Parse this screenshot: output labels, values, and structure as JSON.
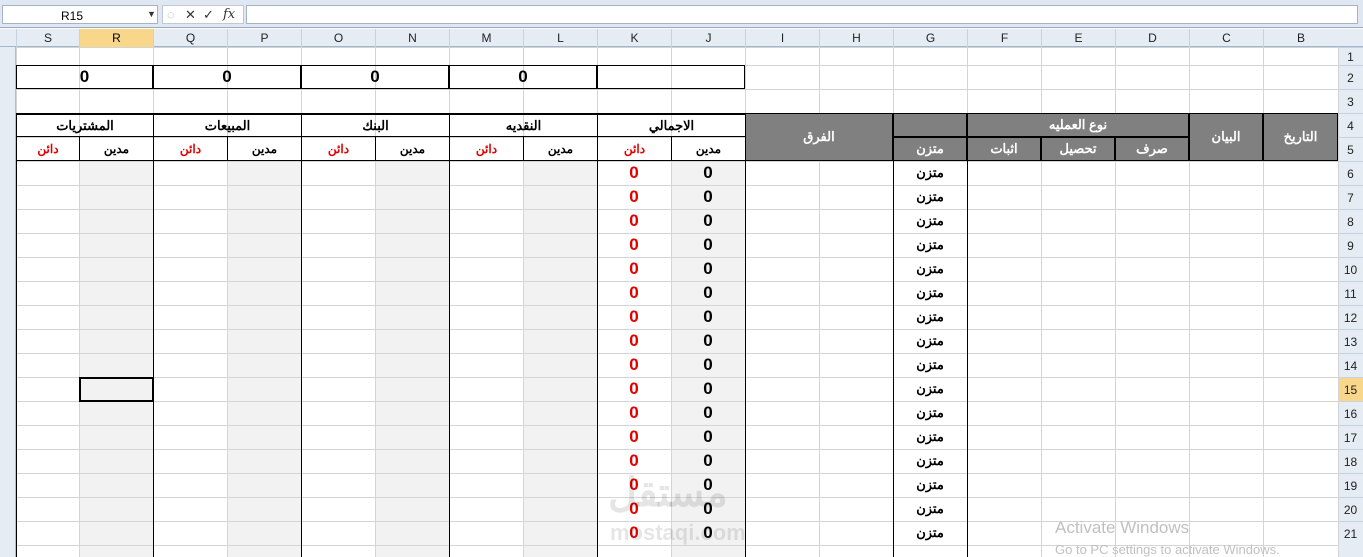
{
  "formula_bar": {
    "name_box": "R15",
    "formula": ""
  },
  "columns": [
    "S",
    "R",
    "Q",
    "P",
    "O",
    "N",
    "M",
    "L",
    "K",
    "J",
    "I",
    "H",
    "G",
    "F",
    "E",
    "D",
    "C",
    "B"
  ],
  "selected_column": "R",
  "rows": [
    "1",
    "2",
    "3",
    "4",
    "5",
    "6",
    "7",
    "8",
    "9",
    "10",
    "11",
    "12",
    "13",
    "14",
    "15",
    "16",
    "17",
    "18",
    "19",
    "20",
    "21"
  ],
  "selected_row": "15",
  "totals_row": [
    "0",
    "0",
    "0",
    "0",
    ""
  ],
  "account_groups": [
    "المشتريات",
    "المبيعات",
    "البنك",
    "النقديه",
    "الاجمالي"
  ],
  "debit_label": "مدين",
  "credit_label": "دائن",
  "left_headers": {
    "difference": "الفرق",
    "operation_type": "نوع العمليه",
    "description": "البيان",
    "date": "التاريخ",
    "balanced": "متزن",
    "proof": "اثبات",
    "collection": "تحصيل",
    "expense": "صرف"
  },
  "total_debit_values": [
    "0",
    "0",
    "0",
    "0",
    "0",
    "0",
    "0",
    "0",
    "0",
    "0",
    "0",
    "0",
    "0",
    "0",
    "0",
    "0"
  ],
  "total_credit_values": [
    "0",
    "0",
    "0",
    "0",
    "0",
    "0",
    "0",
    "0",
    "0",
    "0",
    "0",
    "0",
    "0",
    "0",
    "0",
    "0"
  ],
  "balance_status": [
    "متزن",
    "متزن",
    "متزن",
    "متزن",
    "متزن",
    "متزن",
    "متزن",
    "متزن",
    "متزن",
    "متزن",
    "متزن",
    "متزن",
    "متزن",
    "متزن",
    "متزن",
    "متزن"
  ],
  "watermark": {
    "logo": "مستقل",
    "site": "mostaqi.com"
  },
  "activation": {
    "title": "Activate Windows",
    "subtitle": "Go to PC settings to activate Windows."
  }
}
